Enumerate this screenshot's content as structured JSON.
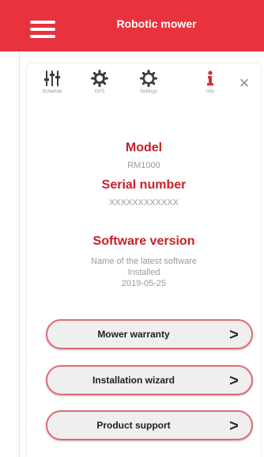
{
  "header": {
    "title": "Robotic mower",
    "menu_icon": "hamburger-icon",
    "color": "#e8323e"
  },
  "toolbar": {
    "items": [
      {
        "label": "Schedule",
        "icon": "sliders-icon"
      },
      {
        "label": "GPS",
        "icon": "gear-icon"
      },
      {
        "label": "Settings",
        "icon": "gear-icon"
      },
      {
        "label": "Info",
        "icon": "info-icon",
        "active": true
      }
    ],
    "close_icon": "close-icon",
    "close_glyph": "×"
  },
  "info": {
    "model_title": "Model",
    "model_value": "RM1000",
    "serial_title": "Serial number",
    "serial_value": "XXXXXXXXXXXX",
    "software_title": "Software version",
    "software_line1": "Name of the latest software",
    "software_line2": "Installed",
    "software_date": "2019-05-25"
  },
  "buttons": [
    {
      "label": "Mower warranty",
      "chevron": ">"
    },
    {
      "label": "Installation wizard",
      "chevron": ">"
    },
    {
      "label": "Product support",
      "chevron": ">"
    }
  ],
  "colors": {
    "accent": "#c8202b",
    "button_border": "#e16b74",
    "button_bg": "#efefef"
  }
}
